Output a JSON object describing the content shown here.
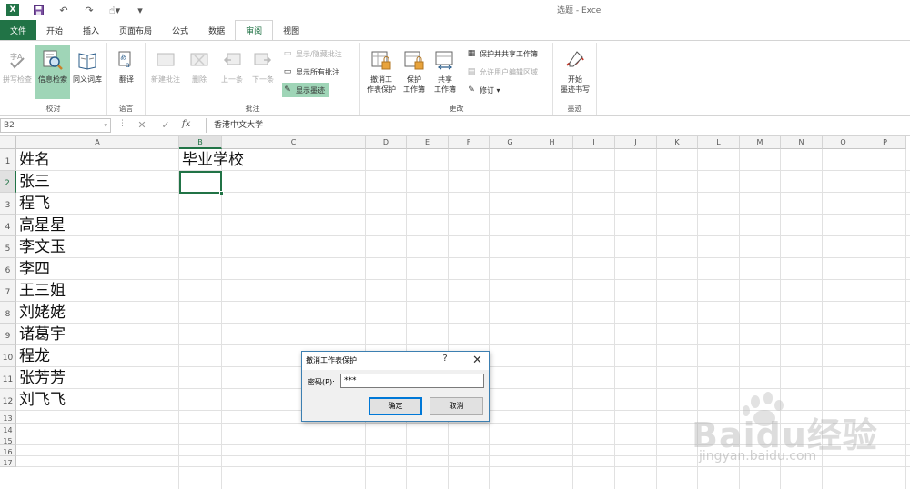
{
  "window": {
    "title": "选题 - Excel",
    "qat_icons": [
      "excel-logo-icon",
      "save-icon",
      "undo-icon",
      "redo-icon",
      "touch-mode-icon",
      "customize-qat-icon"
    ]
  },
  "tabs": [
    {
      "label": "文件"
    },
    {
      "label": "开始"
    },
    {
      "label": "插入"
    },
    {
      "label": "页面布局"
    },
    {
      "label": "公式"
    },
    {
      "label": "数据"
    },
    {
      "label": "审阅"
    },
    {
      "label": "视图"
    }
  ],
  "active_tab": "审阅",
  "ribbon": {
    "proofing": {
      "label": "校对",
      "spelling": "拼写检查",
      "research": "信息检索",
      "thesaurus": "同义词库"
    },
    "language": {
      "label": "语言",
      "translate": "翻译"
    },
    "comments": {
      "label": "批注",
      "new_comment": "新建批注",
      "delete": "删除",
      "previous": "上一条",
      "next": "下一条",
      "show_hide": "显示/隐藏批注",
      "show_all": "显示所有批注",
      "show_ink": "显示墨迹"
    },
    "changes": {
      "label": "更改",
      "unprotect_sheet_l1": "撤消工",
      "unprotect_sheet_l2": "作表保护",
      "protect_workbook_l1": "保护",
      "protect_workbook_l2": "工作簿",
      "share_workbook_l1": "共享",
      "share_workbook_l2": "工作簿",
      "protect_and_share": "保护并共享工作簿",
      "allow_edit_ranges": "允许用户编辑区域",
      "track_changes": "修订"
    },
    "ink": {
      "label": "墨迹",
      "start_inking_l1": "开始",
      "start_inking_l2": "墨迹书写"
    }
  },
  "formula_bar": {
    "name_box": "B2",
    "cancel": "✕",
    "enter": "✓",
    "fx": "fx",
    "content": "香港中文大学"
  },
  "sheet": {
    "columns": [
      "A",
      "B",
      "C",
      "D",
      "E",
      "F",
      "G",
      "H",
      "I",
      "J",
      "K",
      "L",
      "M",
      "N",
      "O",
      "P"
    ],
    "row_numbers": [
      "1",
      "2",
      "3",
      "4",
      "5",
      "6",
      "7",
      "8",
      "9",
      "10",
      "11",
      "12",
      "13",
      "14",
      "15",
      "16",
      "17"
    ],
    "a_values": [
      "姓名",
      "张三",
      "程飞",
      "高星星",
      "李文玉",
      "李四",
      "王三姐",
      "刘姥姥",
      "诸葛宇",
      "程龙",
      "张芳芳",
      "刘飞飞"
    ],
    "b1": "毕业学校",
    "selected_cell": "B2"
  },
  "dialog": {
    "title": "撤消工作表保护",
    "help": "?",
    "close": "✕",
    "password_label": "密码(P):",
    "password_value": "***",
    "ok": "确定",
    "cancel": "取消"
  },
  "watermark": {
    "brand": "Baidu经验",
    "url": "jingyan.baidu.com"
  }
}
